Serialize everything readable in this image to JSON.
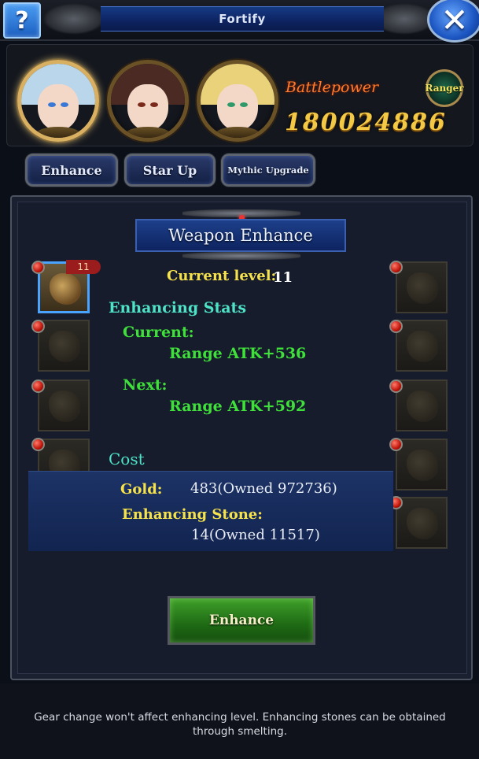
{
  "header": {
    "help_label": "?",
    "title": "Fortify",
    "close_label": "✕"
  },
  "heroes": [
    {
      "hair_color": "#b9d6ea",
      "eye_color": "#3a78d6",
      "selected": true
    },
    {
      "hair_color": "#4a2a22",
      "eye_color": "#7a2a1a",
      "selected": false
    },
    {
      "hair_color": "#ead27a",
      "eye_color": "#2e9a6a",
      "selected": false
    }
  ],
  "battlepower": {
    "label": "Battlepower",
    "value": "180024886"
  },
  "class_badge": "Ranger",
  "tabs": [
    {
      "label": "Enhance"
    },
    {
      "label": "Star Up"
    },
    {
      "label": "Mythic Upgrade"
    }
  ],
  "panel": {
    "title": "Weapon Enhance",
    "current_level_label": "Current level:",
    "current_level_value": "11",
    "selected_slot_level": "11",
    "stats_heading": "Enhancing Stats",
    "current_label": "Current:",
    "current_stat": "Range ATK+536",
    "next_label": "Next:",
    "next_stat": "Range ATK+592",
    "cost_heading": "Cost",
    "gold_label": "Gold:",
    "gold_value": "483(Owned 972736)",
    "stone_label": "Enhancing Stone:",
    "stone_value": "14(Owned 11517)",
    "enhance_button": "Enhance"
  },
  "footer": {
    "hint": "Gear change won't affect enhancing level. Enhancing stones can be obtained through smelting."
  },
  "colors": {
    "accent_blue": "#1c56c2",
    "gold_text": "#f2c845",
    "stat_green": "#3fe03a",
    "heading_teal": "#4ee3c7",
    "label_yellow": "#f6e24a"
  }
}
